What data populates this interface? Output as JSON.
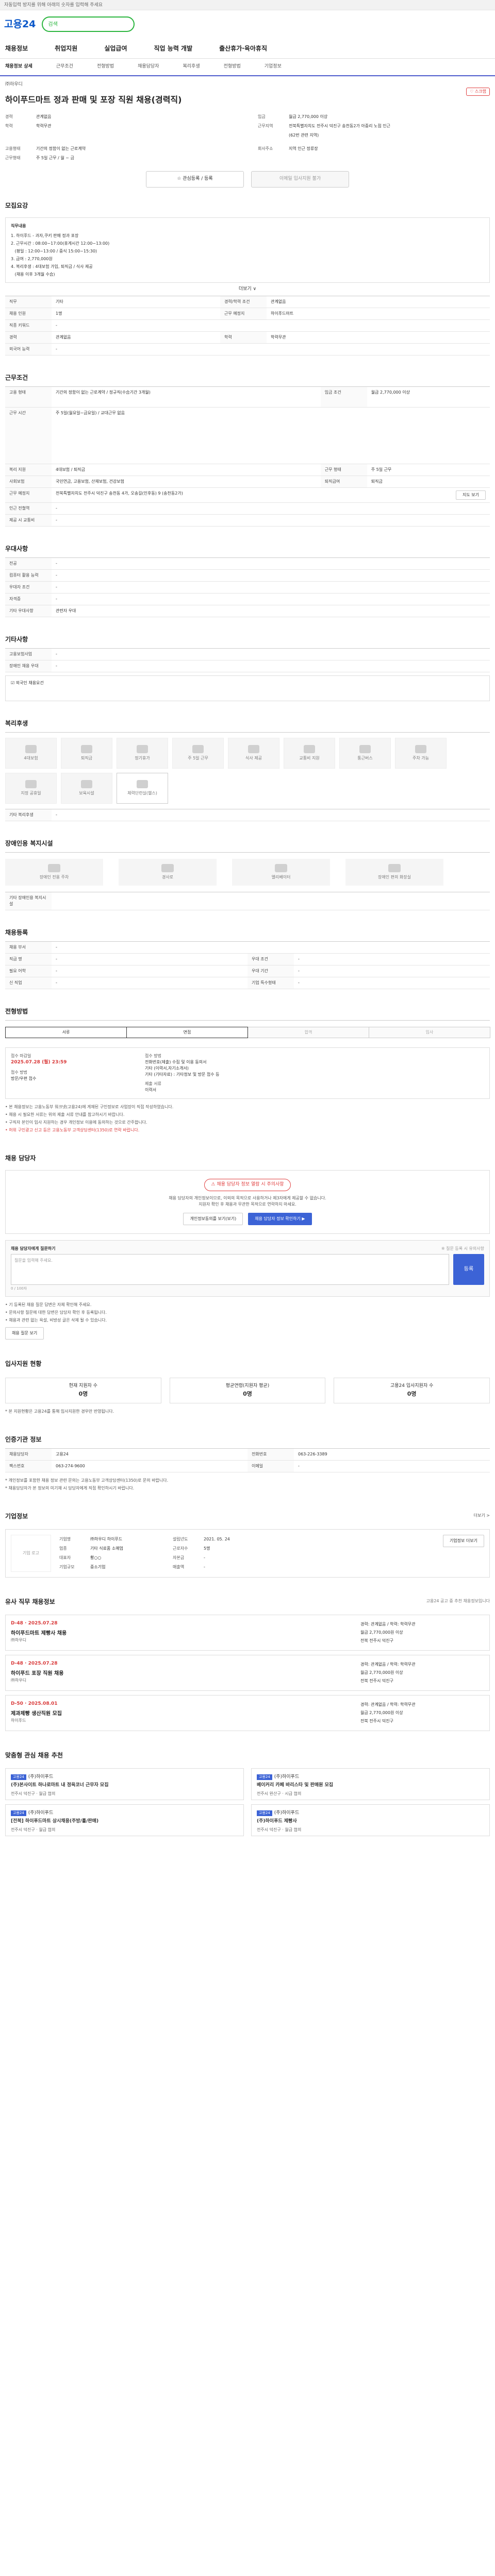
{
  "notice": {
    "text": "자동입력 방지를 위해 아래의 숫자를 입력해 주세요"
  },
  "header": {
    "logo": "고용24",
    "search_placeholder": "검색"
  },
  "gnb": [
    "채용정보",
    "취업지원",
    "실업급여",
    "직업 능력 개발",
    "출산휴가·육아휴직"
  ],
  "tabs": [
    {
      "label": "채용정보 상세",
      "on": true
    },
    {
      "label": "근무조건",
      "on": false
    },
    {
      "label": "전형방법",
      "on": false
    },
    {
      "label": "채용담당자",
      "on": false
    },
    {
      "label": "복리후생",
      "on": false
    },
    {
      "label": "전형방법",
      "on": false
    },
    {
      "label": "기업정보",
      "on": false
    }
  ],
  "job": {
    "company": "㈜하우디",
    "title": "하이푸드마트 정과 판매 및 포장 직원 채용(경력직)",
    "scrap": "♡ 스크랩",
    "left": [
      {
        "k": "경력",
        "v": "관계없음"
      },
      {
        "k": "학력",
        "v": "학력무관"
      }
    ],
    "right": [
      {
        "k": "임금",
        "v": "월급 2,770,000 이상"
      },
      {
        "k": "근무지역",
        "v": "전북특별자치도 전주시 덕진구 송천동2가 아중리 노점 인근"
      },
      {
        "k": "",
        "v": "(62번 관련 지역)"
      }
    ],
    "left2": [
      {
        "k": "고용형태",
        "v": "기간의 정함이 없는 근로계약"
      },
      {
        "k": "근무형태",
        "v": "주 5일 근무 / 월 ~ 금"
      }
    ],
    "right2": [
      {
        "k": "회사주소",
        "v": "지역 인근 정류장"
      }
    ],
    "btn_apply": "☆ 관심등록 / 등록",
    "btn_msg": "이메일 입사지원 불가"
  },
  "detail": {
    "title": "모집요강",
    "head": "직무내용",
    "lines": [
      "1. 하이푸드 - 과자,쿠키 판매 정과 포장",
      "2. 근무시간 : 08:00~17:00(휴게시간 12:00~13:00)",
      "   (평일 : 12:00~13:00 / 중식 15:00~15:30)",
      "3. 급여 : 2,770,000원",
      "4. 복리후생 : 4대보험 가입, 퇴직금 / 식사 제공",
      "   (채용 이후 3개월 수습)"
    ],
    "more": "더보기 ∨"
  },
  "req": {
    "rows": [
      [
        "직무",
        "기타",
        "경력/학력 조건",
        "관계없음"
      ],
      [
        "채용 인원",
        "1명",
        "근무 예정지",
        "하이푸드마트"
      ],
      [
        "직종 키워드",
        "-",
        "",
        ""
      ],
      [
        "경력",
        "관계없음",
        "학력",
        "학력무관"
      ],
      [
        "외국어 능력",
        "-",
        "",
        ""
      ]
    ]
  },
  "cond": {
    "title": "근무조건",
    "rows": [
      [
        "고용 형태",
        "기간의 정함이 없는 근로계약 / 정규직(수습기간 3개월)",
        "임금 조건",
        "월급 2,770,000 이상"
      ],
      [
        "근무 시간",
        "주 5일(월요일~금요일) / 교대근무 없음",
        "",
        ""
      ],
      [
        "복리 지원",
        "4대보험 / 퇴직금",
        "근무 형태",
        "주 5일 근무"
      ],
      [
        "사회보험",
        "국민연금, 고용보험, 산재보험, 건강보험",
        "퇴직급여",
        "퇴직금"
      ],
      [
        "근무 예정지",
        "전북특별자치도 전주시 덕진구 송천동 4가, 오송길(인후동) 9 (송천동2가)",
        "",
        ""
      ],
      [
        "인근 전철역",
        "-",
        "",
        ""
      ],
      [
        "제공 시 교통비",
        "-",
        "",
        ""
      ]
    ],
    "addr_btn": "지도 보기"
  },
  "prefs": {
    "title": "우대사항",
    "rows": [
      [
        "전공",
        "-"
      ],
      [
        "컴퓨터 활용 능력",
        "-"
      ],
      [
        "우대자 조건",
        "-"
      ],
      [
        "자격증",
        "-"
      ],
      [
        "기타 우대사항",
        "관련자 우대"
      ]
    ]
  },
  "etc": {
    "title": "기타사항",
    "rows": [
      [
        "고용보험사업",
        "-"
      ],
      [
        "장애인 채용 우대",
        "-"
      ]
    ],
    "note": "☑ 외국인 채용요건"
  },
  "welfare": {
    "title": "복리후생",
    "items": [
      "4대보험",
      "퇴직금",
      "정기휴가",
      "주 5일 근무",
      "식사 제공",
      "교통비 지원",
      "통근버스",
      "주차 가능",
      "지정 공휴일",
      "보육시설",
      "체력단련실(헬스)",
      "-"
    ],
    "etc_label": "기타 복리후생"
  },
  "disab": {
    "title": "장애인용 복지시설",
    "items": [
      "장애인 전용 주차",
      "경사로",
      "엘리베이터",
      "장애인 편의 화장실"
    ],
    "etc_label": "기타 장애인용 복지시설"
  },
  "hiring": {
    "title": "채용등록",
    "rows": [
      [
        "채용 부서",
        "-",
        "",
        ""
      ],
      [
        "직급 명",
        "-",
        "우대 조건",
        "-"
      ],
      [
        "필요 어학",
        "-",
        "우대 기간",
        "-"
      ],
      [
        "신 직업",
        "-",
        "기업 특수형태",
        "-"
      ]
    ]
  },
  "process": {
    "title": "전형방법",
    "steps": [
      "서류",
      "면접",
      "합격",
      "입사"
    ],
    "col1_h": "접수 마감일",
    "col1_v": "2025.07.28 (월) 23:59",
    "col1_s": "접수 방법",
    "col1_s2": "방문/우편 접수",
    "col2_h": "접수 방법",
    "col2_lines": [
      "전화번호(제출) 수집 및 이용 동의서",
      "기타 (이력서,자기소개서)",
      "기타 (기타자료) : 기타정보 및 방문 접수 등"
    ],
    "col2_sub": "제출 서류",
    "col2_sub2": "이력서",
    "notes": [
      "• 본 채용정보는 고용노동부 워크넷(고용24)에 게재된 구인정보로 사업장이 직접 작성하였습니다.",
      "• 채용 시 필요한 서류는 위의 제출 서류 안내를 참고하시기 바랍니다.",
      "• 구직자 본인이 입사 지원하는 경우 개인정보 이용에 동의하는 것으로 간주합니다."
    ],
    "red": "• 허위 구인광고 신고 등은 고용노동부 고객상담센터(1350)로 연락 바랍니다."
  },
  "contact": {
    "title": "채용 담당자",
    "badge": "⚠ 채용 담당자 정보 열람 시 주의사항",
    "lines": [
      "채용 담당자의 개인정보이므로, 이외의 목적으로 사용하거나 제3자에게 제공할 수 없습니다.",
      "지원자 확인 후 채용과 무관한 목적으로 연락하지 마세요."
    ],
    "btn1": "개인정보동의를 보기(보기)",
    "btn2": "채용 담당자 정보 확인하기 ▶",
    "q_label": "채용 담당자에게 질문하기",
    "q_hint": "※ 질문 등록 시 유의사항",
    "q_placeholder": "질문을 입력해 주세요.",
    "q_submit": "등록",
    "q_count": "0 / 100자",
    "q_notes": [
      "• 기 등록된 채용 질문 답변은 자체 확인해 주세요.",
      "• 문의사항 질문에 대한 답변은 담당자 확인 후 등록됩니다.",
      "• 채용과 관련 없는 욕설, 비방성 글은 삭제 될 수 있습니다."
    ],
    "q_btn": "채용 질문 보기"
  },
  "stats": {
    "title": "입사지원 현황",
    "items": [
      {
        "l": "현재 지원자 수",
        "v": "0명"
      },
      {
        "l": "평균연령(지원자 평균)",
        "v": "0명"
      },
      {
        "l": "고용24 입사지원자 수",
        "v": "0명"
      }
    ],
    "note": "* 본 지원현황은 고용24를 통해 입사지원한 경우만 반영됩니다."
  },
  "contactinfo": {
    "title": "인증기관 정보",
    "rows": [
      [
        "채용담당자",
        "고용24",
        "전화번호",
        "063-226-3389"
      ],
      [
        "팩스번호",
        "063-274-9600",
        "이메일",
        "-"
      ]
    ],
    "addr_btn": "지도 보기",
    "notes": [
      "* 개인정보를 포함한 채용 정보 관련 문의는 고용노동부 고객상담센터(1350)로 문의 바랍니다.",
      "* 채용담당자가 본 정보의 미기재 시 담당자에게 직접 확인하시기 바랍니다."
    ]
  },
  "company": {
    "title": "기업정보",
    "more": "더보기 >",
    "logo": "기업 로고",
    "rows": [
      [
        "기업명",
        "㈜하우디 하이푸드",
        "설립년도",
        "2021. 05. 24"
      ],
      [
        "업종",
        "기타 식료품 소매업",
        "근로자수",
        "5명"
      ],
      [
        "대표자",
        "황○○",
        "자본금",
        "-"
      ],
      [
        "기업규모",
        "중소기업",
        "매출액",
        "-"
      ]
    ],
    "btn": "기업정보 더보기"
  },
  "similar": {
    "title": "유사 직무 채용정보",
    "note": "고용24 공고 중 추천 채용정보입니다",
    "cards": [
      {
        "dd": "D-48 · 2025.07.28",
        "t": "하이푸드마트 제빵사 채용",
        "c": "㈜하우디",
        "m1": "경력: 관계없음 / 학력: 학력무관",
        "m2": "월급 2,770,000원 이상",
        "m3": "전북 전주시 덕진구"
      },
      {
        "dd": "D-48 · 2025.07.28",
        "t": "하이푸드 포장 직원 채용",
        "c": "㈜하우디",
        "m1": "경력: 관계없음 / 학력: 학력무관",
        "m2": "월급 2,770,000원 이상",
        "m3": "전북 전주시 덕진구"
      },
      {
        "dd": "D-50 · 2025.08.01",
        "t": "제과제빵 생산직원 모집",
        "c": "하이푸드",
        "m1": "경력: 관계없음 / 학력: 학력무관",
        "m2": "월급 2,770,000원 이상",
        "m3": "전북 전주시 덕진구"
      }
    ]
  },
  "recommend": {
    "title": "맞춤형 관심 채용 추천",
    "cards": [
      {
        "tag": "고용24",
        "n": "(주)하이푸드",
        "t": "(주)본사이트 하나로마트 내 정육코너 근무자 모집",
        "m": "전주시 덕진구 · 월급 협의"
      },
      {
        "tag": "고용24",
        "n": "(주)하이푸드",
        "t": "베이커리 카페 바리스타 및 판매원 모집",
        "m": "전주시 완산구 · 시급 협의"
      },
      {
        "tag": "고용24",
        "n": "(주)하이푸드",
        "t": "[전북] 하이푸드마트 상시채용(주방/홀/판매)",
        "m": "전주시 덕진구 · 월급 협의"
      },
      {
        "tag": "고용24",
        "n": "(주)하이푸드",
        "t": "(주)하이푸드 제빵사",
        "m": "전주시 덕진구 · 월급 협의"
      }
    ]
  }
}
